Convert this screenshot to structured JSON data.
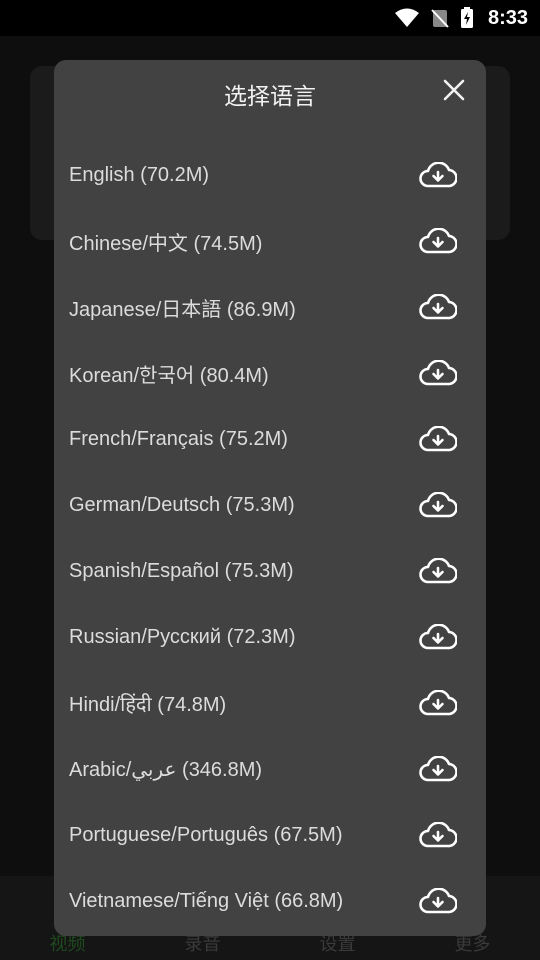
{
  "status": {
    "time": "8:33"
  },
  "dialog": {
    "title": "选择语言",
    "languages": [
      {
        "label": "English (70.2M)"
      },
      {
        "label": "Chinese/中文 (74.5M)"
      },
      {
        "label": "Japanese/日本語 (86.9M)"
      },
      {
        "label": "Korean/한국어 (80.4M)"
      },
      {
        "label": "French/Français (75.2M)"
      },
      {
        "label": "German/Deutsch (75.3M)"
      },
      {
        "label": "Spanish/Español (75.3M)"
      },
      {
        "label": "Russian/Русский (72.3M)"
      },
      {
        "label": "Hindi/हिंदी (74.8M)"
      },
      {
        "label": "Arabic/عربي (346.8M)"
      },
      {
        "label": "Portuguese/Português (67.5M)"
      },
      {
        "label": "Vietnamese/Tiếng Việt (66.8M)"
      }
    ],
    "download_icon": "cloud-download-icon",
    "close_icon": "close-icon"
  },
  "bottom_nav": {
    "items": [
      {
        "label": "视频"
      },
      {
        "label": "录音"
      },
      {
        "label": "设置"
      },
      {
        "label": "更多"
      }
    ]
  },
  "colors": {
    "dialog_bg": "#424242",
    "overlay_bg": "#0b0b0b",
    "text": "#dcdcdc",
    "active_nav": "#1f4a1f"
  }
}
